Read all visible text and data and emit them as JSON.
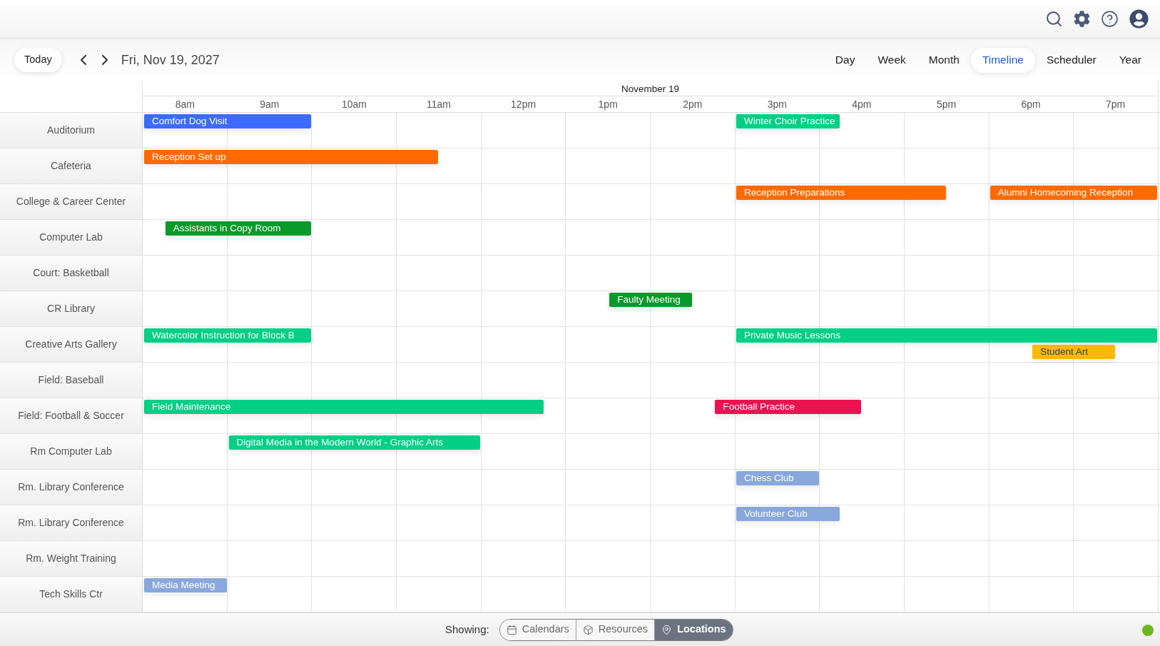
{
  "toolbar": {
    "today_button": "Today",
    "date": "Fri, Nov 19, 2027",
    "views": [
      {
        "label": "Day",
        "selected": false
      },
      {
        "label": "Week",
        "selected": false
      },
      {
        "label": "Month",
        "selected": false
      },
      {
        "label": "Timeline",
        "selected": true
      },
      {
        "label": "Scheduler",
        "selected": false
      },
      {
        "label": "Year",
        "selected": false
      }
    ]
  },
  "timeline": {
    "date_header": "November 19",
    "hours": [
      "8am",
      "9am",
      "10am",
      "11am",
      "12pm",
      "1pm",
      "2pm",
      "3pm",
      "4pm",
      "5pm",
      "6pm",
      "7pm"
    ],
    "locations": [
      {
        "name": "Auditorium",
        "events": [
          {
            "title": "Comfort Dog Visit",
            "color": "#3d6bff"
          },
          {
            "title": "Winter Choir Practice",
            "color": "#00cf86"
          }
        ]
      },
      {
        "name": "Cafeteria",
        "events": [
          {
            "title": "Reception Set up",
            "color": "#ff6a00"
          }
        ]
      },
      {
        "name": "College & Career Center",
        "events": [
          {
            "title": "Reception Preparations",
            "color": "#ff6a00"
          },
          {
            "title": "Alumni Homecoming Reception",
            "color": "#ff6a00"
          }
        ]
      },
      {
        "name": "Computer Lab",
        "events": [
          {
            "title": "Assistants in Copy Room",
            "color": "#0a9a2a"
          }
        ]
      },
      {
        "name": "Court: Basketball"
      },
      {
        "name": "CR Library",
        "events": [
          {
            "title": "Faulty Meeting",
            "color": "#0a9a2a"
          }
        ]
      },
      {
        "name": "Creative Arts Gallery",
        "events": [
          {
            "title": "Watercolor Instruction for Block B",
            "color": "#00cf86"
          },
          {
            "title": "Private Music Lessons",
            "color": "#00cf86"
          },
          {
            "title": "Student Art",
            "color": "#ffb800"
          }
        ]
      },
      {
        "name": "Field: Baseball"
      },
      {
        "name": "Field: Football & Soccer",
        "events": [
          {
            "title": "Field Maintenance",
            "color": "#00cf86"
          },
          {
            "title": "Football Practice",
            "color": "#ee1150"
          }
        ]
      },
      {
        "name": "Rm Computer Lab",
        "events": [
          {
            "title": "Digital Media in the Modern World - Graphic Arts",
            "color": "#00cf86"
          }
        ]
      },
      {
        "name": "Rm. Library Conference",
        "events": [
          {
            "title": "Chess Club",
            "color": "#88a7dc"
          }
        ]
      },
      {
        "name": "Rm. Library Conference",
        "events": [
          {
            "title": "Volunteer Club",
            "color": "#88a7dc"
          }
        ]
      },
      {
        "name": "Rm. Weight Training"
      },
      {
        "name": "Tech Skills Ctr",
        "events": [
          {
            "title": "Media Meeting",
            "color": "#88a7dc"
          }
        ]
      }
    ]
  },
  "footer": {
    "label": "Showing:",
    "options": [
      {
        "label": "Calendars",
        "selected": false
      },
      {
        "label": "Resources",
        "selected": false
      },
      {
        "label": "Locations",
        "selected": true
      }
    ]
  }
}
